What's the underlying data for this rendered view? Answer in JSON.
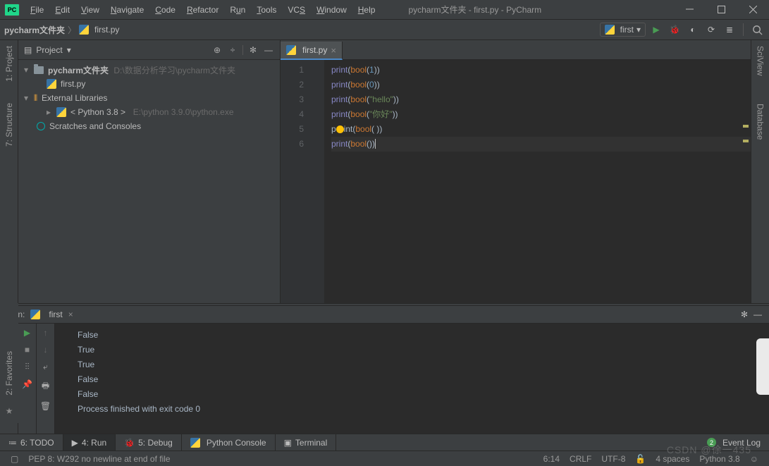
{
  "window": {
    "title": "pycharm文件夹 - first.py - PyCharm"
  },
  "menu": {
    "items": [
      {
        "u": "F",
        "r": "ile"
      },
      {
        "u": "E",
        "r": "dit"
      },
      {
        "u": "V",
        "r": "iew"
      },
      {
        "u": "N",
        "r": "avigate"
      },
      {
        "u": "C",
        "r": "ode"
      },
      {
        "u": "R",
        "r": "efactor"
      },
      {
        "u": "R",
        "r": "un",
        "pre": ""
      },
      {
        "u": "T",
        "r": "ools"
      },
      {
        "u": "V",
        "r": "CS",
        "pre": ""
      },
      {
        "u": "W",
        "r": "indow"
      },
      {
        "u": "H",
        "r": "elp"
      }
    ],
    "labels": [
      "File",
      "Edit",
      "View",
      "Navigate",
      "Code",
      "Refactor",
      "Run",
      "Tools",
      "VCS",
      "Window",
      "Help"
    ]
  },
  "breadcrumb": {
    "a": "pycharm文件夹",
    "b": "first.py"
  },
  "run_config": {
    "name": "first"
  },
  "project": {
    "title": "Project",
    "root": "pycharm文件夹",
    "root_path": "D:\\数据分析学习\\pycharm文件夹",
    "file": "first.py",
    "ext_lib": "External Libraries",
    "python": "< Python 3.8 >",
    "python_path": "E:\\python 3.9.0\\python.exe",
    "scratches": "Scratches and Consoles"
  },
  "left_tools": {
    "a": "1: Project",
    "b": "7: Structure"
  },
  "right_tools": {
    "a": "SciView",
    "b": "Database"
  },
  "editor": {
    "tab": "first.py",
    "lines": [
      "1",
      "2",
      "3",
      "4",
      "5",
      "6"
    ],
    "code": {
      "l1": {
        "fn": "print",
        "kw": "bool",
        "arg": "1"
      },
      "l2": {
        "fn": "print",
        "kw": "bool",
        "arg": "0"
      },
      "l3": {
        "fn": "print",
        "kw": "bool",
        "str": "\"hello\""
      },
      "l4": {
        "fn": "print",
        "kw": "bool",
        "str": "\"你好\""
      },
      "l5": {
        "fn": "print",
        "kw": "bool",
        "arg": " "
      },
      "l6": {
        "fn": "print",
        "kw": "bool"
      }
    }
  },
  "run": {
    "label": "Run:",
    "name": "first",
    "out": [
      "False",
      "True",
      "True",
      "False",
      "False",
      "",
      "Process finished with exit code 0"
    ]
  },
  "favs": {
    "label": "2: Favorites"
  },
  "bottom": {
    "todo": "6: TODO",
    "run": "4: Run",
    "debug": "5: Debug",
    "console": "Python Console",
    "terminal": "Terminal",
    "event": "Event Log",
    "badge": "2"
  },
  "status": {
    "msg": "PEP 8: W292 no newline at end of file",
    "pos": "6:14",
    "eol": "CRLF",
    "enc": "UTF-8",
    "indent": "4 spaces",
    "interp": "Python 3.8"
  },
  "watermark": "CSDN @徐一435"
}
